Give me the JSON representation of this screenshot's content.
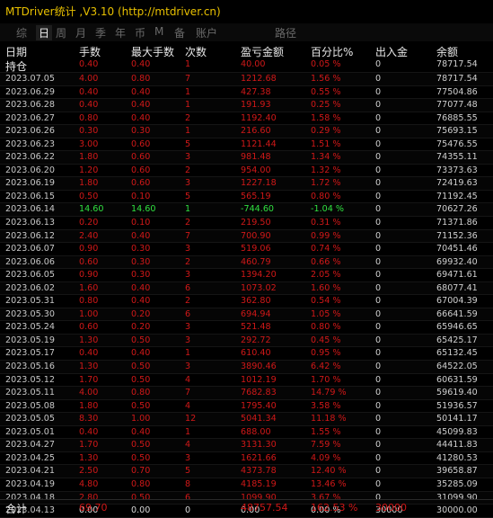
{
  "window": {
    "title": "MTDriver统计 ,V3.10 (http://mtdriver.cn)"
  },
  "tabs": [
    {
      "label": "综",
      "active": false
    },
    {
      "label": "日",
      "active": true
    },
    {
      "label": "周",
      "active": false
    },
    {
      "label": "月",
      "active": false
    },
    {
      "label": "季",
      "active": false
    },
    {
      "label": "年",
      "active": false
    },
    {
      "label": "币",
      "active": false
    },
    {
      "label": "M",
      "active": false
    },
    {
      "label": "备",
      "active": false
    },
    {
      "label": "账户",
      "active": false
    },
    {
      "label": "路径",
      "active": false
    }
  ],
  "table": {
    "columns": [
      "日期",
      "手数",
      "最大手数",
      "次数",
      "盈亏金额",
      "百分比%",
      "出入金",
      "余额"
    ],
    "rows": [
      [
        "持仓",
        "0.40",
        "0.40",
        "1",
        "40.00",
        "0.05 %",
        "0",
        "78717.54"
      ],
      [
        "2023.07.05",
        "4.00",
        "0.80",
        "7",
        "1212.68",
        "1.56 %",
        "0",
        "78717.54"
      ],
      [
        "2023.06.29",
        "0.40",
        "0.40",
        "1",
        "427.38",
        "0.55 %",
        "0",
        "77504.86"
      ],
      [
        "2023.06.28",
        "0.40",
        "0.40",
        "1",
        "191.93",
        "0.25 %",
        "0",
        "77077.48"
      ],
      [
        "2023.06.27",
        "0.80",
        "0.40",
        "2",
        "1192.40",
        "1.58 %",
        "0",
        "76885.55"
      ],
      [
        "2023.06.26",
        "0.30",
        "0.30",
        "1",
        "216.60",
        "0.29 %",
        "0",
        "75693.15"
      ],
      [
        "2023.06.23",
        "3.00",
        "0.60",
        "5",
        "1121.44",
        "1.51 %",
        "0",
        "75476.55"
      ],
      [
        "2023.06.22",
        "1.80",
        "0.60",
        "3",
        "981.48",
        "1.34 %",
        "0",
        "74355.11"
      ],
      [
        "2023.06.20",
        "1.20",
        "0.60",
        "2",
        "954.00",
        "1.32 %",
        "0",
        "73373.63"
      ],
      [
        "2023.06.19",
        "1.80",
        "0.60",
        "3",
        "1227.18",
        "1.72 %",
        "0",
        "72419.63"
      ],
      [
        "2023.06.15",
        "0.50",
        "0.10",
        "5",
        "565.19",
        "0.80 %",
        "0",
        "71192.45"
      ],
      [
        "2023.06.14",
        "14.60",
        "14.60",
        "1",
        "-744.60",
        "-1.04 %",
        "0",
        "70627.26"
      ],
      [
        "2023.06.13",
        "0.20",
        "0.10",
        "2",
        "219.50",
        "0.31 %",
        "0",
        "71371.86"
      ],
      [
        "2023.06.12",
        "2.40",
        "0.40",
        "7",
        "700.90",
        "0.99 %",
        "0",
        "71152.36"
      ],
      [
        "2023.06.07",
        "0.90",
        "0.30",
        "3",
        "519.06",
        "0.74 %",
        "0",
        "70451.46"
      ],
      [
        "2023.06.06",
        "0.60",
        "0.30",
        "2",
        "460.79",
        "0.66 %",
        "0",
        "69932.40"
      ],
      [
        "2023.06.05",
        "0.90",
        "0.30",
        "3",
        "1394.20",
        "2.05 %",
        "0",
        "69471.61"
      ],
      [
        "2023.06.02",
        "1.60",
        "0.40",
        "6",
        "1073.02",
        "1.60 %",
        "0",
        "68077.41"
      ],
      [
        "2023.05.31",
        "0.80",
        "0.40",
        "2",
        "362.80",
        "0.54 %",
        "0",
        "67004.39"
      ],
      [
        "2023.05.30",
        "1.00",
        "0.20",
        "6",
        "694.94",
        "1.05 %",
        "0",
        "66641.59"
      ],
      [
        "2023.05.24",
        "0.60",
        "0.20",
        "3",
        "521.48",
        "0.80 %",
        "0",
        "65946.65"
      ],
      [
        "2023.05.19",
        "1.30",
        "0.50",
        "3",
        "292.72",
        "0.45 %",
        "0",
        "65425.17"
      ],
      [
        "2023.05.17",
        "0.40",
        "0.40",
        "1",
        "610.40",
        "0.95 %",
        "0",
        "65132.45"
      ],
      [
        "2023.05.16",
        "1.30",
        "0.50",
        "3",
        "3890.46",
        "6.42 %",
        "0",
        "64522.05"
      ],
      [
        "2023.05.12",
        "1.70",
        "0.50",
        "4",
        "1012.19",
        "1.70 %",
        "0",
        "60631.59"
      ],
      [
        "2023.05.11",
        "4.00",
        "0.80",
        "7",
        "7682.83",
        "14.79 %",
        "0",
        "59619.40"
      ],
      [
        "2023.05.08",
        "1.80",
        "0.50",
        "4",
        "1795.40",
        "3.58 %",
        "0",
        "51936.57"
      ],
      [
        "2023.05.05",
        "8.30",
        "1.00",
        "12",
        "5041.34",
        "11.18 %",
        "0",
        "50141.17"
      ],
      [
        "2023.05.01",
        "0.40",
        "0.40",
        "1",
        "688.00",
        "1.55 %",
        "0",
        "45099.83"
      ],
      [
        "2023.04.27",
        "1.70",
        "0.50",
        "4",
        "3131.30",
        "7.59 %",
        "0",
        "44411.83"
      ],
      [
        "2023.04.25",
        "1.30",
        "0.50",
        "3",
        "1621.66",
        "4.09 %",
        "0",
        "41280.53"
      ],
      [
        "2023.04.21",
        "2.50",
        "0.70",
        "5",
        "4373.78",
        "12.40 %",
        "0",
        "39658.87"
      ],
      [
        "2023.04.19",
        "4.80",
        "0.80",
        "8",
        "4185.19",
        "13.46 %",
        "0",
        "35285.09"
      ],
      [
        "2023.04.18",
        "2.80",
        "0.50",
        "6",
        "1099.90",
        "3.67 %",
        "0",
        "31099.90"
      ],
      [
        "2023.04.13",
        "0.00",
        "0.00",
        "0",
        "0.00",
        "0.00 %",
        "30000",
        "30000.00"
      ]
    ],
    "total": {
      "label": "合计",
      "lots": "69.70",
      "profit": "48757.54",
      "percent": "162.53 %",
      "io": "30000"
    }
  },
  "colors": {
    "positive": "#d01818",
    "negative": "#30e040",
    "title": "#e8c000",
    "background": "#000000"
  }
}
